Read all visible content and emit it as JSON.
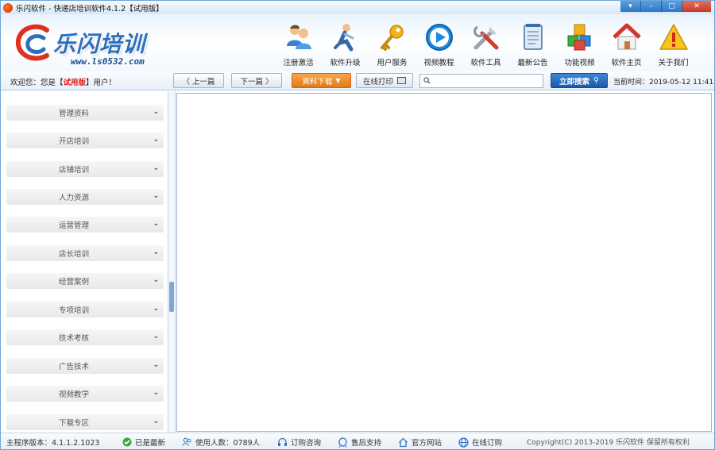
{
  "window": {
    "title": "乐闪软件 - 快递店培训软件4.1.2【试用版】",
    "controls": [
      "▾",
      "–",
      "□",
      "✕"
    ]
  },
  "logo": {
    "title": "乐闪培训",
    "url": "www.ls0532.com"
  },
  "toolbar": [
    {
      "label": "注册激活",
      "icon": "users-icon"
    },
    {
      "label": "软件升级",
      "icon": "runner-icon"
    },
    {
      "label": "用户服务",
      "icon": "key-icon"
    },
    {
      "label": "视频教程",
      "icon": "play-icon"
    },
    {
      "label": "软件工具",
      "icon": "tools-icon"
    },
    {
      "label": "最新公告",
      "icon": "notepad-icon"
    },
    {
      "label": "功能视频",
      "icon": "cubes-icon"
    },
    {
      "label": "软件主页",
      "icon": "home-icon"
    },
    {
      "label": "关于我们",
      "icon": "warning-icon"
    }
  ],
  "nav": {
    "welcome_prefix": "欢迎您：您是【",
    "edition": "试用版",
    "welcome_suffix": "】用户！",
    "prev": "上一篇",
    "next": "下一篇",
    "download": "資料下载",
    "print": "在线打印",
    "search_placeholder": "",
    "search_button": "立即搜索",
    "clock": "当前时间：2019-05-12 11:41"
  },
  "sidebar": {
    "items": [
      "管理资料",
      "开店培训",
      "店铺培训",
      "人力资源",
      "运营管理",
      "店长培训",
      "经营案例",
      "专项培训",
      "技术考核",
      "广告技术",
      "视频教学",
      "下载专区"
    ]
  },
  "status": {
    "version": "主程序版本：4.1.1.2.1023",
    "latest": "已是最新",
    "users": "使用人数：0789人",
    "consult": "订购咨询",
    "support": "售后支持",
    "website": "官方网站",
    "order": "在线订购",
    "copyright": "Copyright(C) 2013-2019 乐闪软件 保留所有权利"
  },
  "colors": {
    "brand_blue": "#2c6fbf",
    "download_orange": "#e27a15",
    "edition_red": "#e02020"
  }
}
